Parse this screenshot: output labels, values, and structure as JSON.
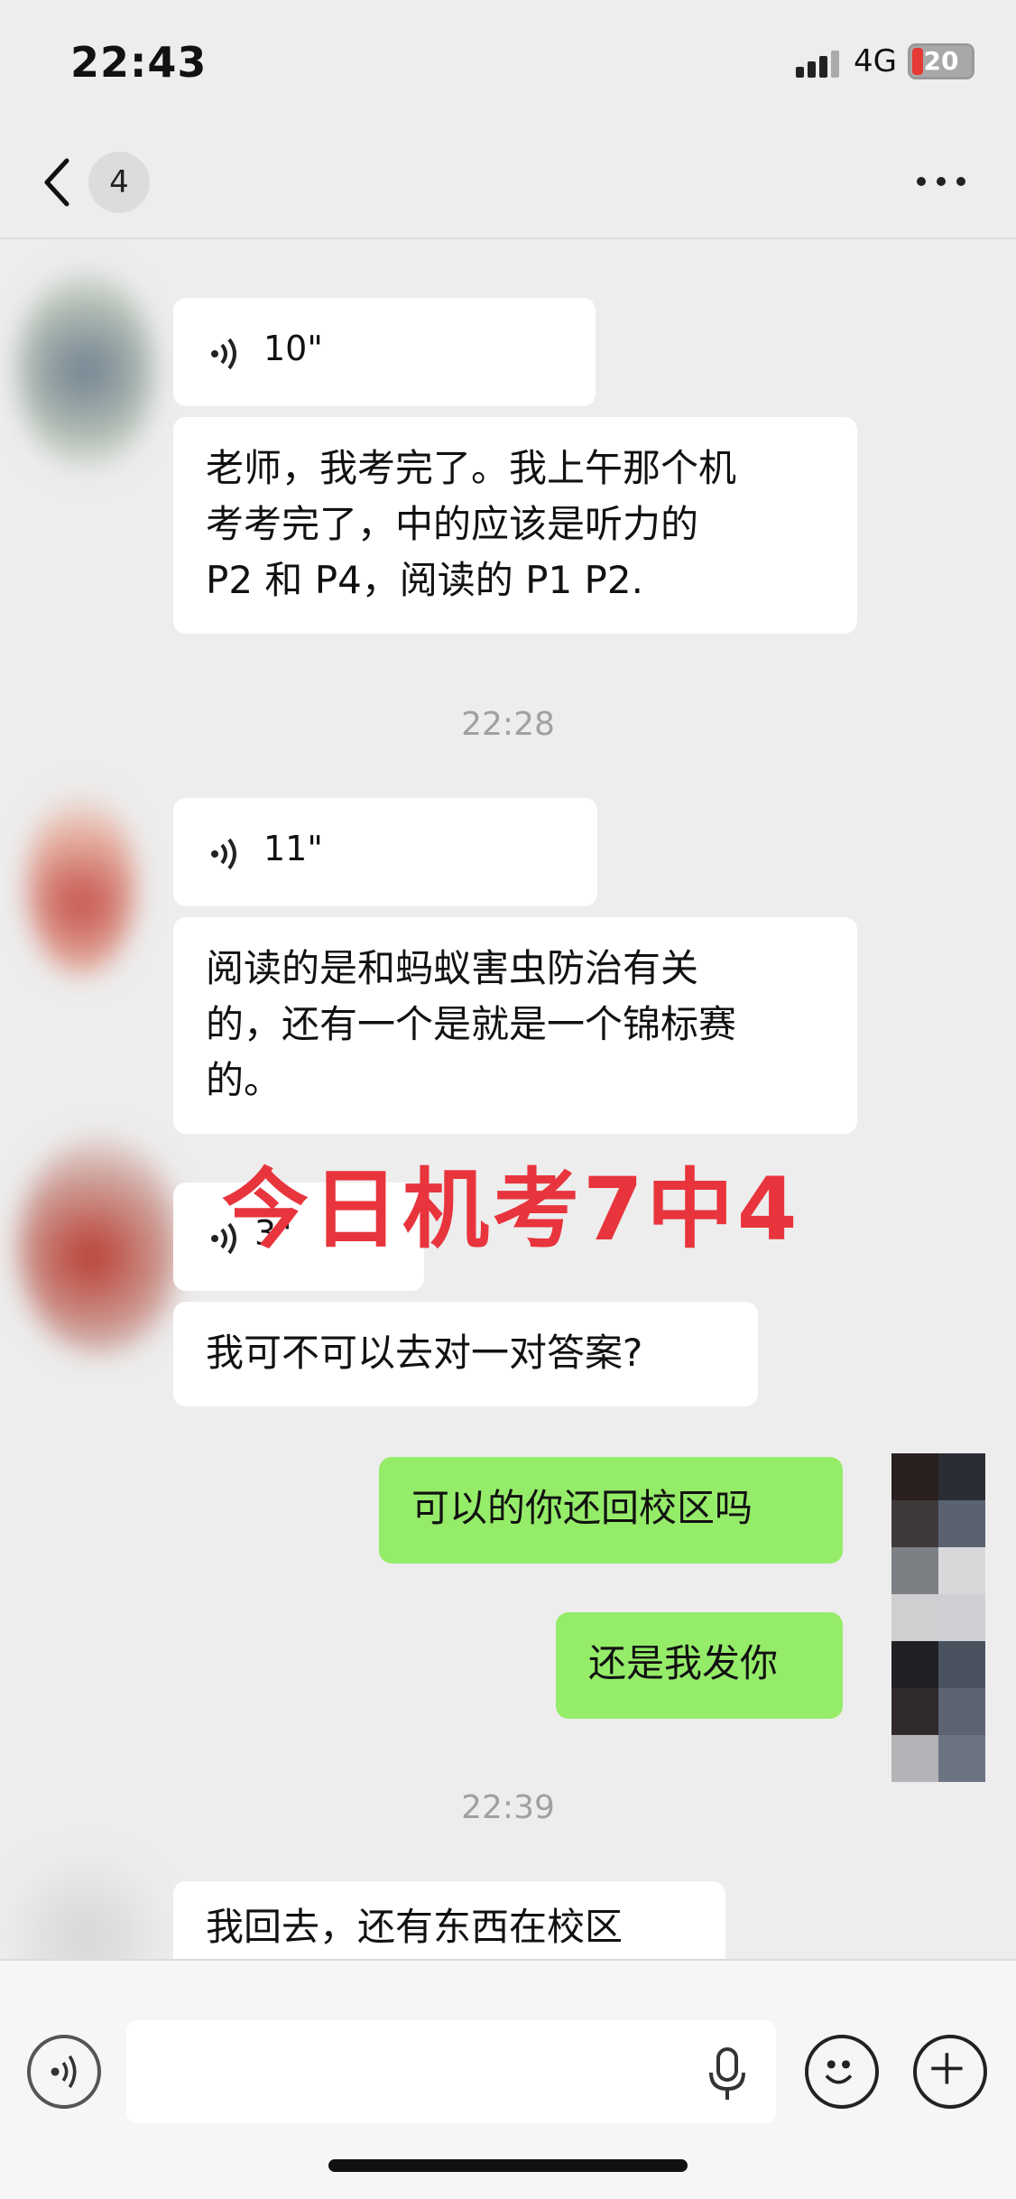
{
  "status_bar": {
    "time": "22:43",
    "network": "4G",
    "battery": "20",
    "signal_icon": "signal-bars-icon"
  },
  "nav": {
    "unread_count": "4",
    "back_icon": "chevron-left-icon",
    "more_icon": "ellipsis-icon"
  },
  "messages": [
    {
      "type": "voice",
      "side": "left",
      "duration": "10\""
    },
    {
      "type": "text",
      "side": "left",
      "lines": [
        "老师，我考完了。我上午那个机",
        "考考完了，中的应该是听力的",
        "P2 和 P4，阅读的 P1 P2."
      ]
    },
    {
      "type": "time",
      "text": "22:28"
    },
    {
      "type": "voice",
      "side": "left",
      "duration": "11\""
    },
    {
      "type": "text",
      "side": "left",
      "lines": [
        "阅读的是和蚂蚁害虫防治有关",
        "的，还有一个是就是一个锦标赛",
        "的。"
      ]
    },
    {
      "type": "voice",
      "side": "left",
      "duration": "3\""
    },
    {
      "type": "text",
      "side": "left",
      "lines": [
        "我可不可以去对一对答案?"
      ]
    },
    {
      "type": "text",
      "side": "right",
      "lines": [
        "可以的你还回校区吗"
      ]
    },
    {
      "type": "text",
      "side": "right",
      "lines": [
        "还是我发你"
      ]
    },
    {
      "type": "time",
      "text": "22:39"
    },
    {
      "type": "text",
      "side": "left",
      "lines": [
        "我回去，还有东西在校区"
      ]
    }
  ],
  "overlay_stamp": "今日机考7中4",
  "input_bar": {
    "voice_icon": "voice-wave-icon",
    "mic_icon": "microphone-icon",
    "emoji_icon": "smiley-icon",
    "plus_icon": "plus-circle-icon"
  },
  "colors": {
    "background": "#ededed",
    "bubble_left": "#ffffff",
    "bubble_right": "#95ec69",
    "stamp": "#e8343c"
  }
}
